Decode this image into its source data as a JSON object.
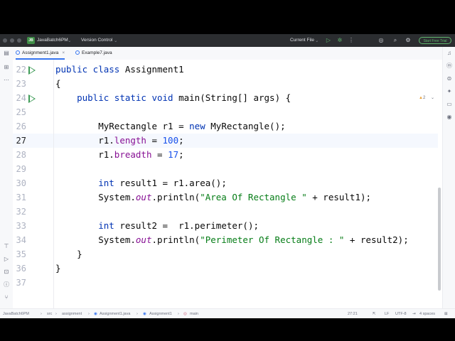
{
  "titlebar": {
    "project_badge": "JB",
    "project_name": "JavaBatch6PM",
    "vcs": "Version Control",
    "run_config": "Current File",
    "trial_button": "Start Free Trial"
  },
  "tabs": [
    {
      "label": "Assignment1.java",
      "active": true
    },
    {
      "label": "Example7.java",
      "active": false
    }
  ],
  "editor": {
    "lines": [
      {
        "n": "22",
        "text": "public class Assignment1"
      },
      {
        "n": "23",
        "text": "{"
      },
      {
        "n": "24",
        "text": "    public static void main(String[] args) {"
      },
      {
        "n": "25",
        "text": ""
      },
      {
        "n": "26",
        "text": "        MyRectangle r1 = new MyRectangle();"
      },
      {
        "n": "27",
        "text": "        r1.length = 100;"
      },
      {
        "n": "28",
        "text": "        r1.breadth = 17;"
      },
      {
        "n": "29",
        "text": ""
      },
      {
        "n": "30",
        "text": "        int result1 = r1.area();"
      },
      {
        "n": "31",
        "text": "        System.out.println(\"Area Of Rectangle \" + result1);"
      },
      {
        "n": "32",
        "text": ""
      },
      {
        "n": "33",
        "text": "        int result2 =  r1.perimeter();"
      },
      {
        "n": "34",
        "text": "        System.out.println(\"Perimeter Of Rectangle : \" + result2);"
      },
      {
        "n": "35",
        "text": "    }"
      },
      {
        "n": "36",
        "text": "}"
      },
      {
        "n": "37",
        "text": ""
      }
    ],
    "current_line": "27",
    "warnings": "2"
  },
  "breadcrumb": [
    "JavaBatch6PM",
    "src",
    "assignment",
    "Assignment1.java",
    "Assignment1",
    "main"
  ],
  "status": {
    "position": "27:21",
    "line_sep": "LF",
    "encoding": "UTF-8",
    "indent": "4 spaces"
  },
  "colors": {
    "keyword": "#0033b3",
    "number": "#1750eb",
    "string": "#067d17",
    "field": "#871094",
    "run_icon": "#3d9b56",
    "accent": "#3574f0"
  }
}
